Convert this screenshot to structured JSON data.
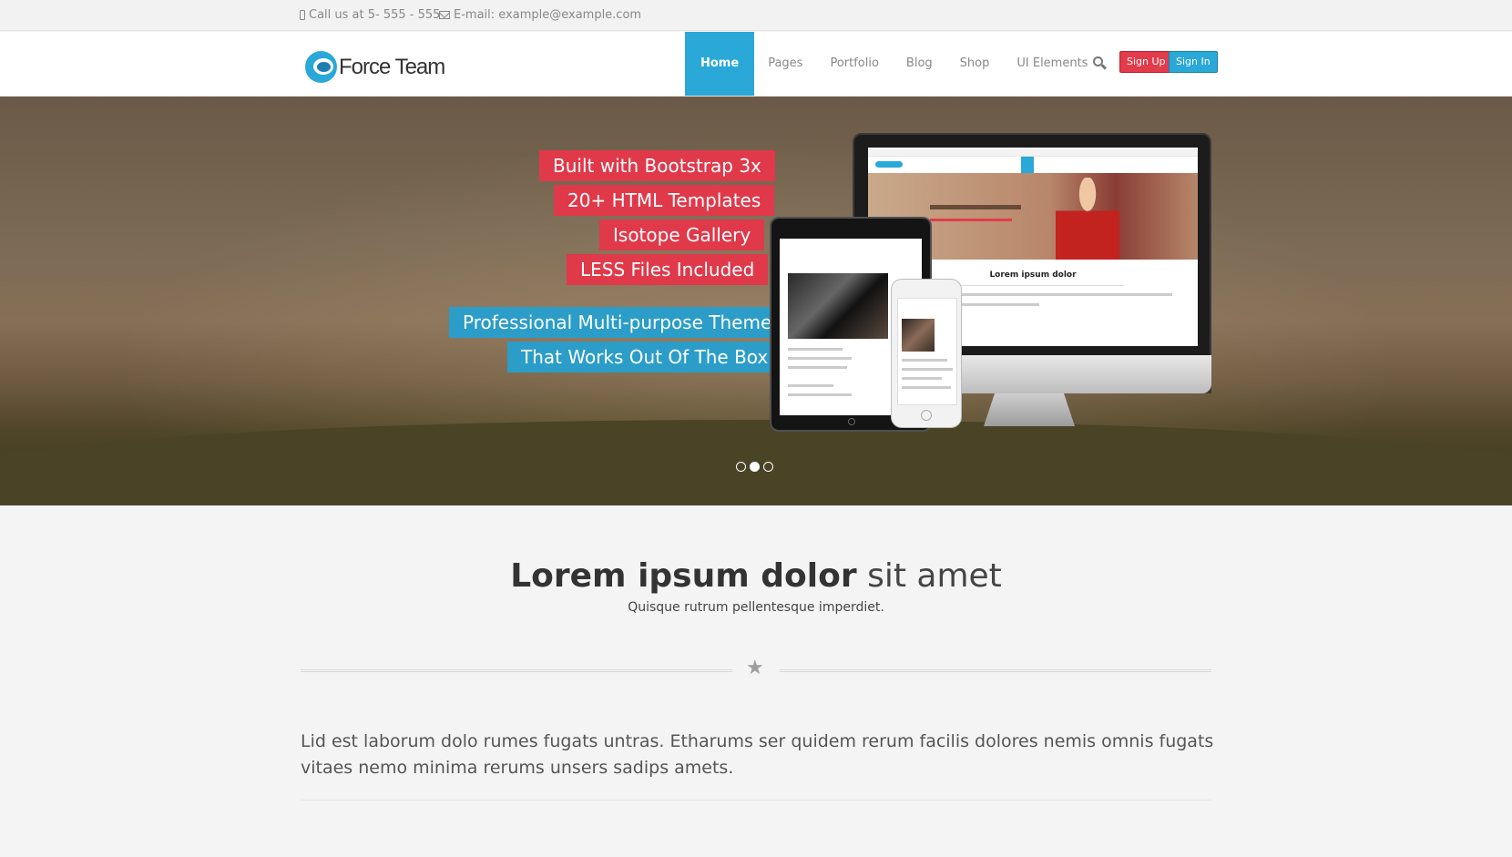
{
  "topbar": {
    "phone": "Call us at 5- 555 - 555",
    "email": "E-mail: example@example.com"
  },
  "header": {
    "logo_text": "Force Team",
    "nav": [
      "Home",
      "Pages",
      "Portfolio",
      "Blog",
      "Shop",
      "UI Elements"
    ],
    "active_nav": "Home",
    "signup_label": "Sign Up",
    "signin_label": "Sign In"
  },
  "hero": {
    "features": [
      "Built with Bootstrap 3x",
      "20+ HTML Templates",
      "Isotope Gallery",
      "LESS Files Included"
    ],
    "taglines": [
      "Professional Multi-purpose Theme",
      "That Works Out Of The Box"
    ],
    "slides": 3,
    "active_slide": 2
  },
  "content": {
    "title_bold": "Lorem ipsum dolor",
    "title_light": "sit amet",
    "subtitle": "Quisque rutrum pellentesque imperdiet.",
    "paragraph": "Lid est laborum dolo rumes fugats untras. Etharums ser quidem rerum facilis dolores nemis omnis fugats vitaes nemo minima rerums unsers sadips amets."
  },
  "colors": {
    "accent_blue": "#2aa8d8",
    "accent_red": "#e0394a"
  }
}
